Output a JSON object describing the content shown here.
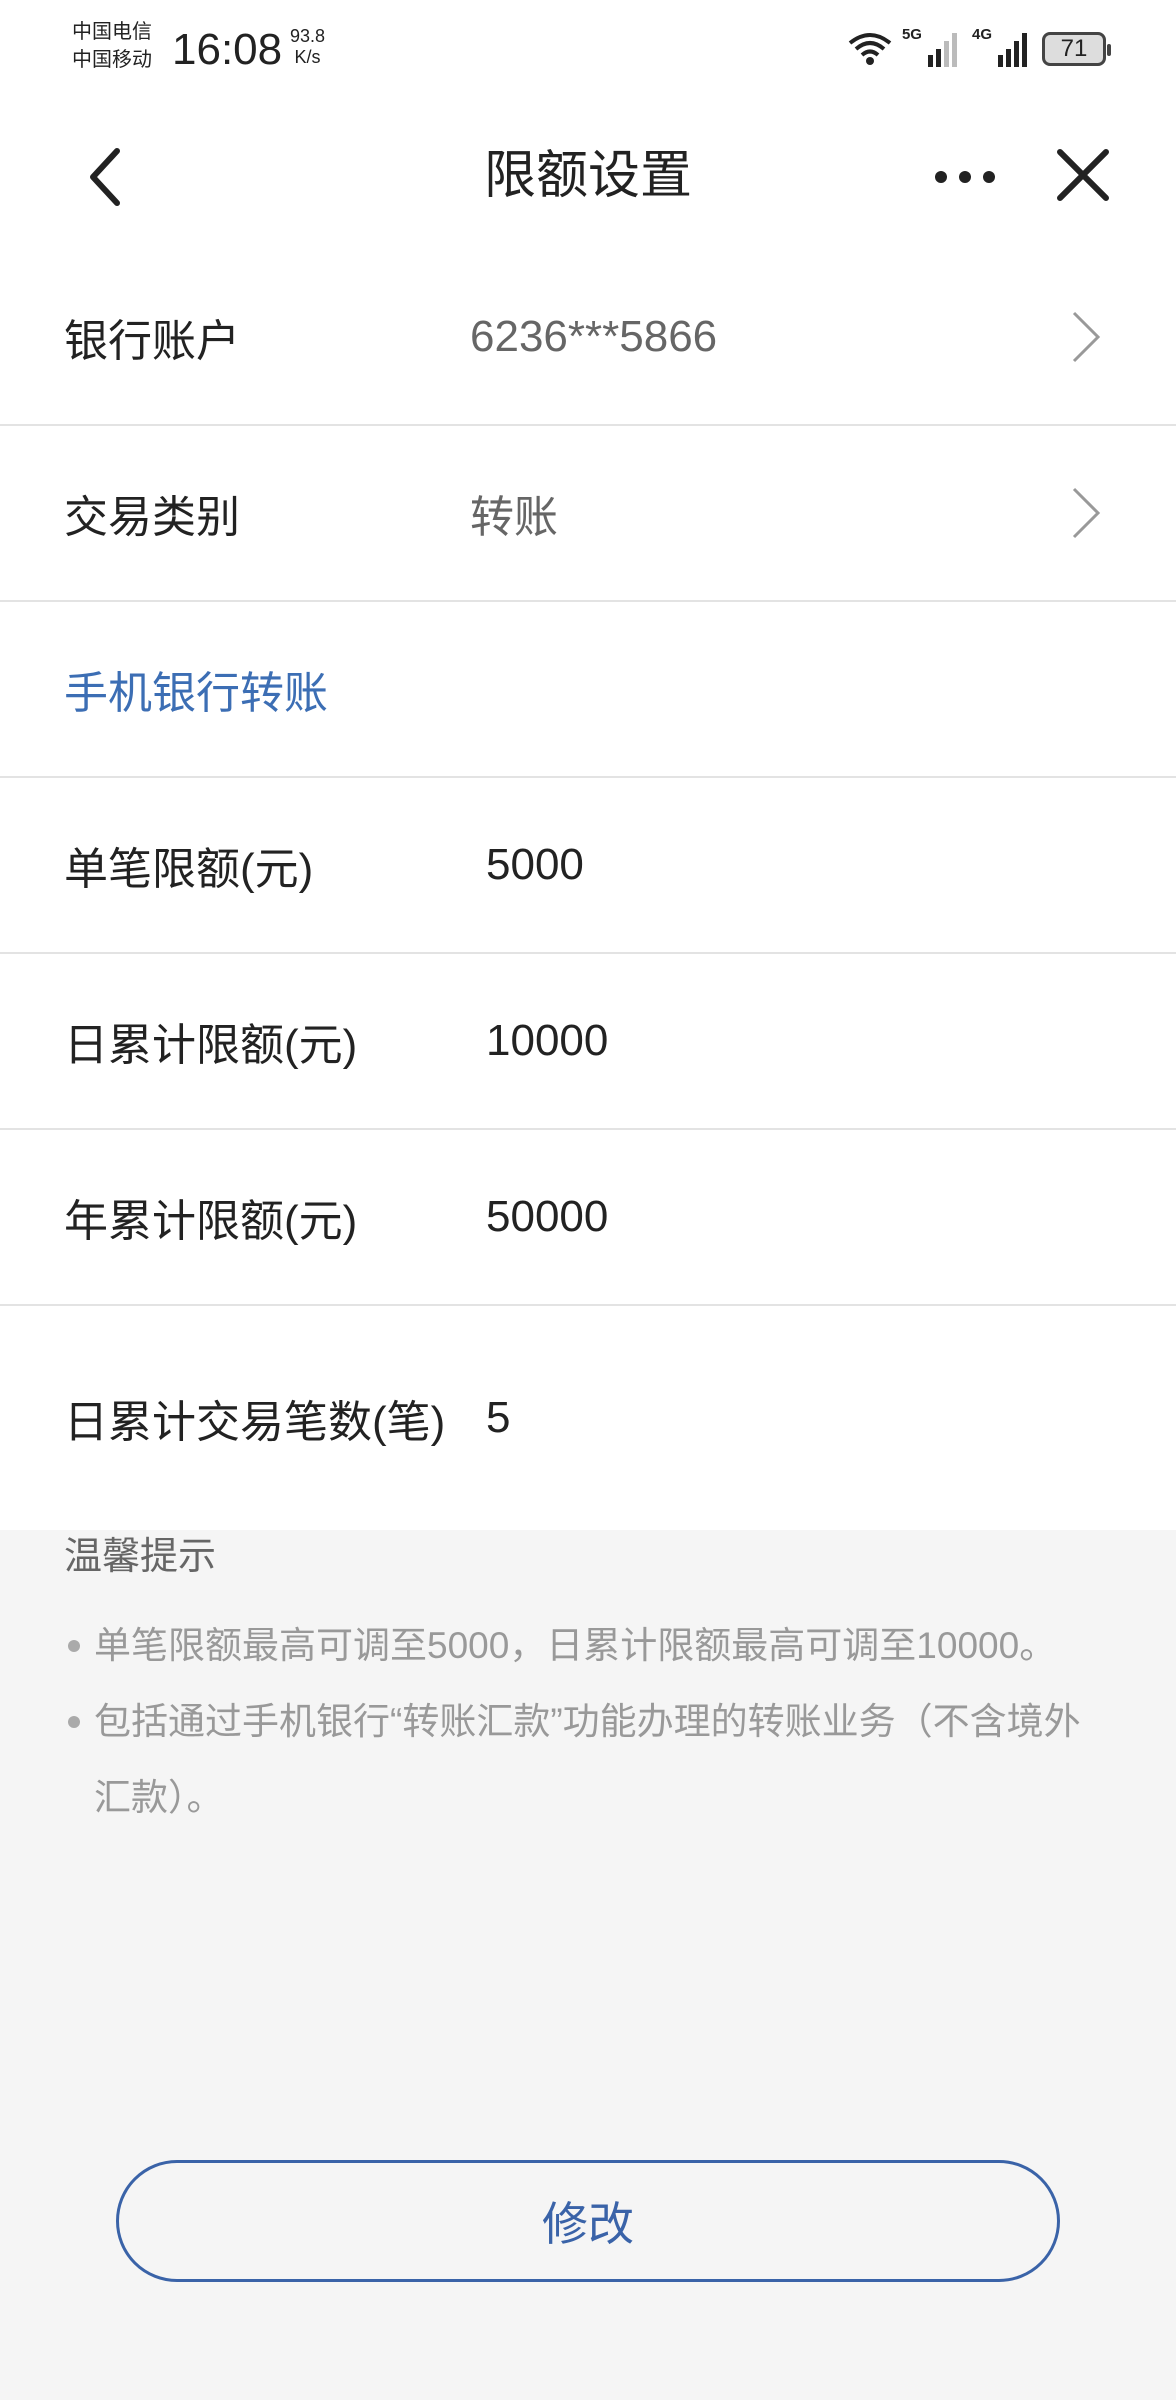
{
  "status_bar": {
    "carrier_1": "中国电信",
    "carrier_2": "中国移动",
    "time": "16:08",
    "net_speed_value": "93.8",
    "net_speed_unit": "K/s",
    "sig_5g": "5G",
    "sig_4g": "4G",
    "battery": "71"
  },
  "header": {
    "title": "限额设置",
    "back_icon": "chevron-left-icon",
    "more_icon": "more-dots-icon",
    "close_icon": "close-icon"
  },
  "account_row": {
    "label": "银行账户",
    "value": "6236***5866"
  },
  "type_row": {
    "label": "交易类别",
    "value": "转账"
  },
  "section": {
    "label": "手机银行转账"
  },
  "limits": [
    {
      "label": "单笔限额(元)",
      "value": "5000"
    },
    {
      "label": "日累计限额(元)",
      "value": "10000"
    },
    {
      "label": "年累计限额(元)",
      "value": "50000"
    },
    {
      "label": "日累计交易笔数(笔)",
      "value": "5"
    }
  ],
  "tips": {
    "title": "温馨提示",
    "items": [
      "单笔限额最高可调至5000，日累计限额最高可调至10000。",
      "包括通过手机银行“转账汇款”功能办理的转账业务（不含境外汇款）。"
    ]
  },
  "actions": {
    "modify_label": "修改"
  },
  "colors": {
    "accent": "#3c6eb4",
    "button_border": "#3a63a8",
    "background": "#f5f5f5"
  }
}
